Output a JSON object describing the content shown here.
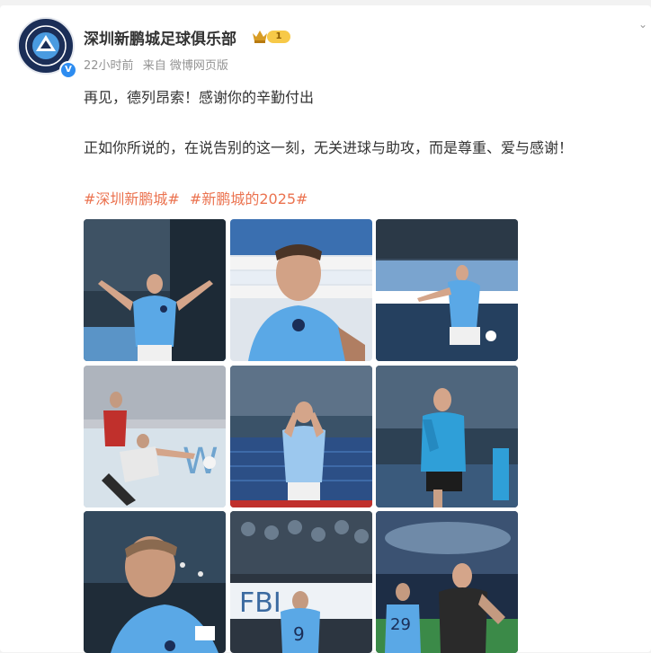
{
  "post": {
    "author": "深圳新鹏城足球俱乐部",
    "level": "1",
    "time": "22小时前",
    "source": "来自 微博网页版",
    "line1": "再见，德列昂索！感谢你的辛勤付出",
    "line2": "正如你所说的，在说告别的这一刻，无关进球与助攻，而是尊重、爱与感谢！",
    "hashtags": [
      "#深圳新鹏城#",
      "#新鹏城的2025#"
    ]
  },
  "photos": [
    {
      "desc": "player-arms-outstretched"
    },
    {
      "desc": "player-closeup-sponsor-board"
    },
    {
      "desc": "player-kicking-ball"
    },
    {
      "desc": "training-tackle"
    },
    {
      "desc": "player-hand-gesture"
    },
    {
      "desc": "player-training-jacket"
    },
    {
      "desc": "player-portrait-closeup"
    },
    {
      "desc": "player-number-9-back"
    },
    {
      "desc": "player-number-29-stadium"
    }
  ],
  "colors": {
    "hashtag": "#eb7350",
    "sky_blue_kit": "#5aa8e6",
    "navy": "#1b2e57"
  }
}
